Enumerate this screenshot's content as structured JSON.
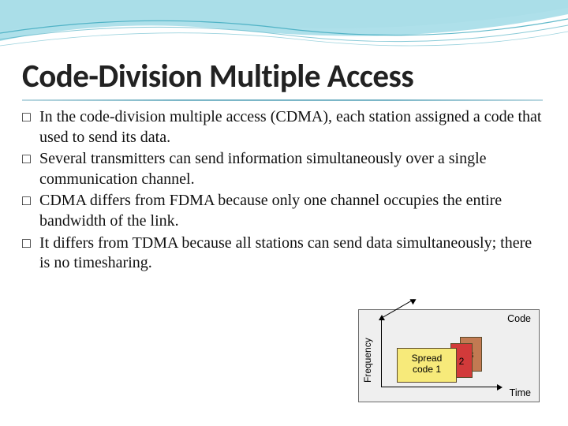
{
  "title": "Code-Division Multiple Access",
  "bullets": [
    "In the code-division multiple access (CDMA), each station assigned a code that used to send its data.",
    "Several transmitters can send information simultaneously over a single communication channel.",
    "CDMA differs from FDMA because only one channel occupies the entire bandwidth of the link.",
    "It differs from TDMA because all stations can send data simultaneously; there is no timesharing."
  ],
  "diagram": {
    "axis_frequency": "Frequency",
    "axis_code": "Code",
    "axis_time": "Time",
    "card1_line1": "Spread",
    "card1_line2": "code 1",
    "card2": "2",
    "card3": "3"
  }
}
